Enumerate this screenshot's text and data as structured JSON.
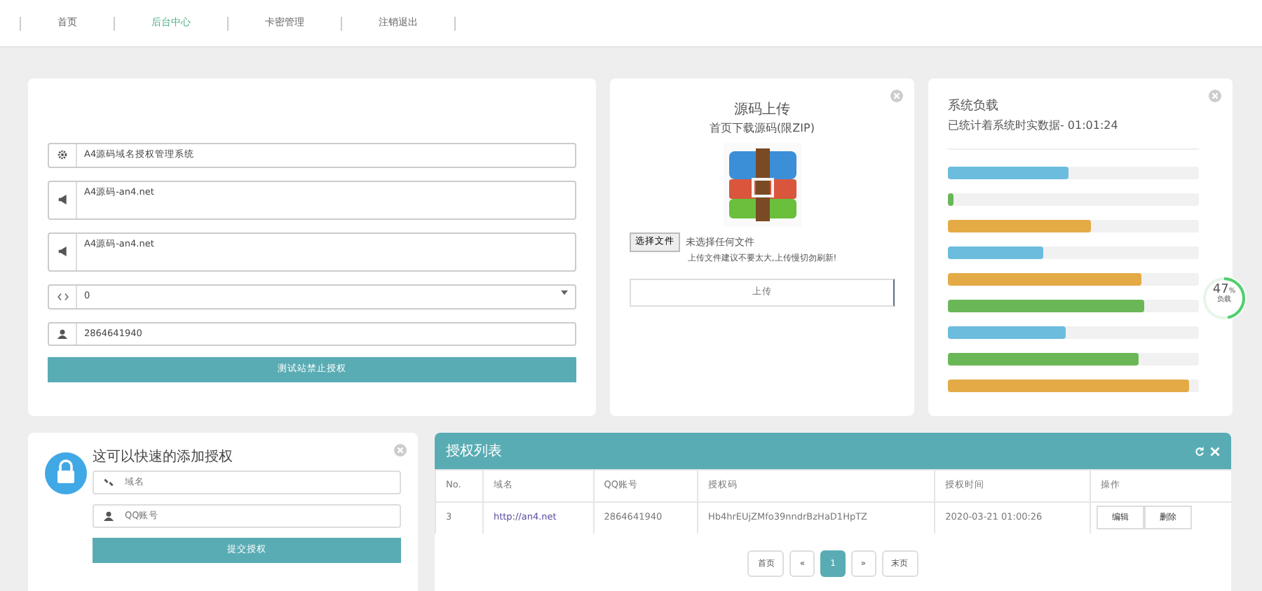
{
  "nav": [
    {
      "label": "首页",
      "selected": false
    },
    {
      "label": "后台中心",
      "selected": true
    },
    {
      "label": "卡密管理",
      "selected": false
    },
    {
      "label": "注销退出",
      "selected": false
    }
  ],
  "settings_form": {
    "fields": [
      {
        "kind": "input",
        "value": "A4源码域名授权管理系统"
      },
      {
        "kind": "textarea",
        "value": "A4源码-an4.net"
      },
      {
        "kind": "textarea",
        "value": "A4源码-an4.net"
      },
      {
        "kind": "select",
        "value": "0"
      },
      {
        "kind": "input",
        "value": "2864641940"
      }
    ],
    "submit": "测试站禁止授权"
  },
  "upload": {
    "title": "源码上传",
    "subtitle": "首页下载源码(限ZIP)",
    "file_button": "选择文件",
    "file_status": "未选择任何文件",
    "hint": "上传文件建议不要太大,上传慢切勿刷新!",
    "submit": "上传"
  },
  "system_load": {
    "title": "系统负载",
    "subtitle": "已统计着系统时实数据- 01:01:24",
    "bars": [
      {
        "level": 0.48,
        "color": "#6bbcdd"
      },
      {
        "level": 0.02,
        "color": "#6ab758"
      },
      {
        "level": 0.57,
        "color": "#e4aa46"
      },
      {
        "level": 0.38,
        "color": "#6bbcdd"
      },
      {
        "level": 0.77,
        "color": "#e4aa46"
      },
      {
        "level": 0.78,
        "color": "#6ab758"
      },
      {
        "level": 0.47,
        "color": "#6bbcdd"
      },
      {
        "level": 0.76,
        "color": "#6ab758"
      },
      {
        "level": 0.96,
        "color": "#e4aa46"
      }
    ],
    "gauge": {
      "value": "47",
      "unit": "%",
      "label": "负载",
      "level": 0.47
    }
  },
  "quick_add": {
    "title": "这可以快速的添加授权",
    "fields": [
      {
        "placeholder": "域名"
      },
      {
        "placeholder": "QQ账号"
      }
    ],
    "submit": "提交授权"
  },
  "license_table": {
    "title": "授权列表",
    "columns": [
      "No.",
      "域名",
      "QQ账号",
      "授权码",
      "授权时间",
      "操作"
    ],
    "rows": [
      {
        "cells": [
          "3",
          "http://an4.net",
          "2864641940",
          "Hb4hrEUjZMfo39nndrBzHaD1HpTZ",
          "2020-03-21 01:00:26"
        ],
        "actions": [
          "编辑",
          "删除"
        ]
      }
    ],
    "pagination": [
      {
        "label": "首页",
        "selected": false
      },
      {
        "label": "«",
        "selected": false
      },
      {
        "label": "1",
        "selected": true
      },
      {
        "label": "»",
        "selected": false
      },
      {
        "label": "末页",
        "selected": false
      }
    ]
  }
}
